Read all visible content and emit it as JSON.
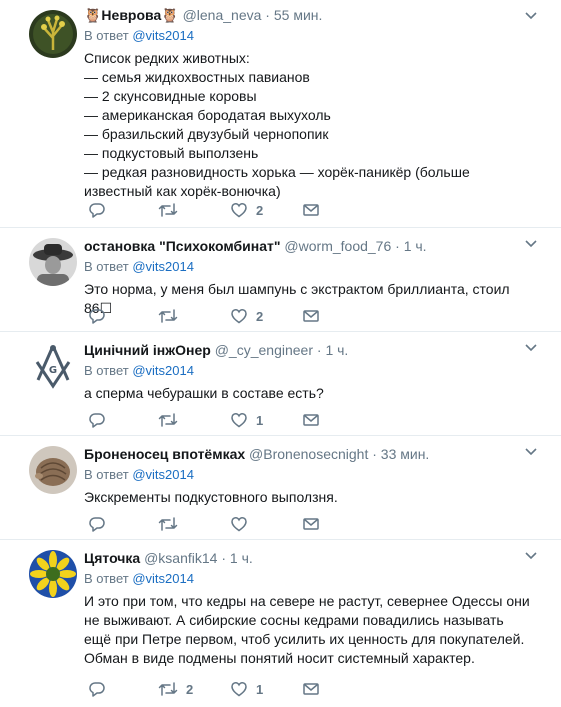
{
  "reply_prefix": "В ответ",
  "colors": {
    "link": "#1b6ec2",
    "muted": "#657786",
    "text": "#14171a",
    "divider": "#e6ecf0"
  },
  "tweets": [
    {
      "name": "🦉Неврова🦉",
      "handle": "@lena_neva",
      "dot": "·",
      "time": "55 мин.",
      "reply_to": "@vits2014",
      "text": "Список редких животных:\n — семья жидкохвостных павианов\n — 2 скунсовидные коровы\n — американская бородатая выхухоль\n — бразильский двузубый чернопопик\n — подкустовый выползень\n — редкая разновидность хорька — хорёк-паникёр (больше известный как хорёк-вонючка)",
      "retweets": "",
      "likes": "2",
      "avatar": "tree-avatar-icon"
    },
    {
      "name": "остановка \"Психокомбинат\"",
      "handle": "@worm_food_76",
      "dot": "·",
      "time": "1 ч.",
      "reply_to": "@vits2014",
      "text": "Это норма, у меня был шампунь с экстрактом бриллианта, стоил 86☐",
      "retweets": "",
      "likes": "2",
      "avatar": "cowboy-photo-avatar"
    },
    {
      "name": "Цинічний інжОнер",
      "handle": "@_cy_engineer",
      "dot": "·",
      "time": "1 ч.",
      "reply_to": "@vits2014",
      "text": "а сперма чебурашки в составе есть?",
      "retweets": "",
      "likes": "1",
      "avatar": "masonic-compass-avatar"
    },
    {
      "name": "Броненосец впотёмках",
      "handle": "@Bronenosecnight",
      "dot": "·",
      "time": "33 мин.",
      "reply_to": "@vits2014",
      "text": "Экскременты подкустовного выползня.",
      "retweets": "",
      "likes": "",
      "avatar": "armadillo-avatar"
    },
    {
      "name": "Цяточка",
      "handle": "@ksanfik14",
      "dot": "·",
      "time": "1 ч.",
      "reply_to": "@vits2014",
      "text": "И это при том, что кедры на севере не растут, севернее Одессы они не выживают. А сибирские сосны кедрами повадились называть ещё при Петре первом, чтоб усилить их ценность для покупателей.\nОбман в виде подмены понятий  носит системный характер.",
      "retweets": "2",
      "likes": "1",
      "avatar": "flower-avatar"
    }
  ]
}
